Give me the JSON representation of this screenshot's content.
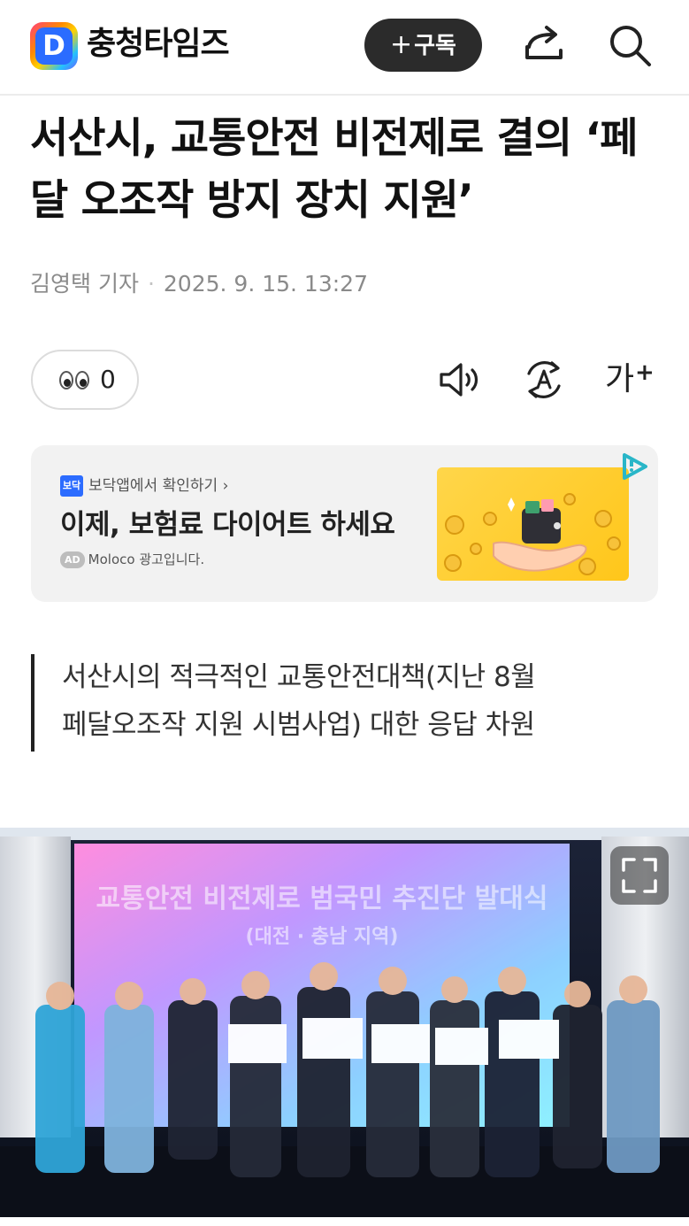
{
  "header": {
    "logo_letter": "D",
    "site_name": "충청타임즈",
    "subscribe_plus": "+",
    "subscribe_label": "구독",
    "share_icon": "share-icon",
    "search_icon": "search-icon"
  },
  "article": {
    "title": "서산시, 교통안전 비전제로 결의 ‘페달 오조작 방지 장치 지원’",
    "author": "김영택 기자",
    "date": "2025. 9. 15. 13:27",
    "summary_lines": [
      "서산시의 적극적인 교통안전대책(지난 8월",
      "페달오조작 지원 시범사업) 대한 응답 차원"
    ]
  },
  "tools": {
    "reaction_count": "0",
    "speaker_icon": "speaker-icon",
    "translate_icon": "translate-icon",
    "font_label": "가",
    "font_plus": "+"
  },
  "ad": {
    "source_badge": "보닥",
    "source_label": "보닥앱에서 확인하기 ›",
    "headline": "이제, 보험료 다이어트 하세요",
    "ad_tag": "AD",
    "disclaimer": "Moloco 광고입니다."
  },
  "photo": {
    "banner_line1": "교통안전 비전제로 범국민 추진단 발대식",
    "banner_line2": "(대전 · 충남 지역)",
    "expand_icon": "expand-icon"
  },
  "colors": {
    "accent_blue": "#2b6cff",
    "subscribe_bg": "#2b2b2b",
    "ad_bg": "#f2f2f2",
    "ad_image_bg": "#ffc61a"
  }
}
